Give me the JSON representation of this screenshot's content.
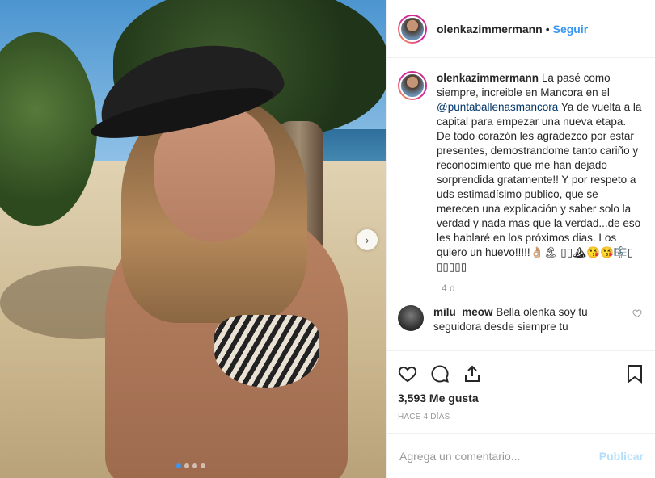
{
  "post": {
    "username": "olenkazimmermann",
    "separator": "•",
    "follow_label": "Seguir",
    "caption": {
      "username": "olenkazimmermann",
      "text_before": "La pasé como siempre, increible en Mancora en el",
      "mention": "@puntaballenasmancora",
      "text_after": "Ya de vuelta a la capital para empezar una nueva etapa. De todo corazón les agradezco por estar presentes, demostrandome tanto cariño y reconocimiento que me han dejado sorprendida gratamente!! Y por respeto a uds estimadísimo publico, que se merecen una explicación y saber solo la verdad y nada mas que la verdad...de eso les hablaré en los próximos dias. Los quiero un huevo!!!!!👌🏼🏝 ▯▯⛰😘😘🎼▯ ▯▯▯▯▯",
      "time": "4 d"
    },
    "comments": [
      {
        "username": "milu_meow",
        "text": "Bella olenka soy tu seguidora desde siempre tu"
      }
    ],
    "likes": "3,593 Me gusta",
    "posted": "HACE 4 DÍAS",
    "add_comment_placeholder": "Agrega un comentario...",
    "publish_label": "Publicar",
    "carousel_next": "›",
    "carousel": {
      "count": 4,
      "active": 0
    }
  },
  "colors": {
    "link": "#3897f0",
    "publish_disabled": "#b2dffc",
    "muted": "#999999"
  }
}
